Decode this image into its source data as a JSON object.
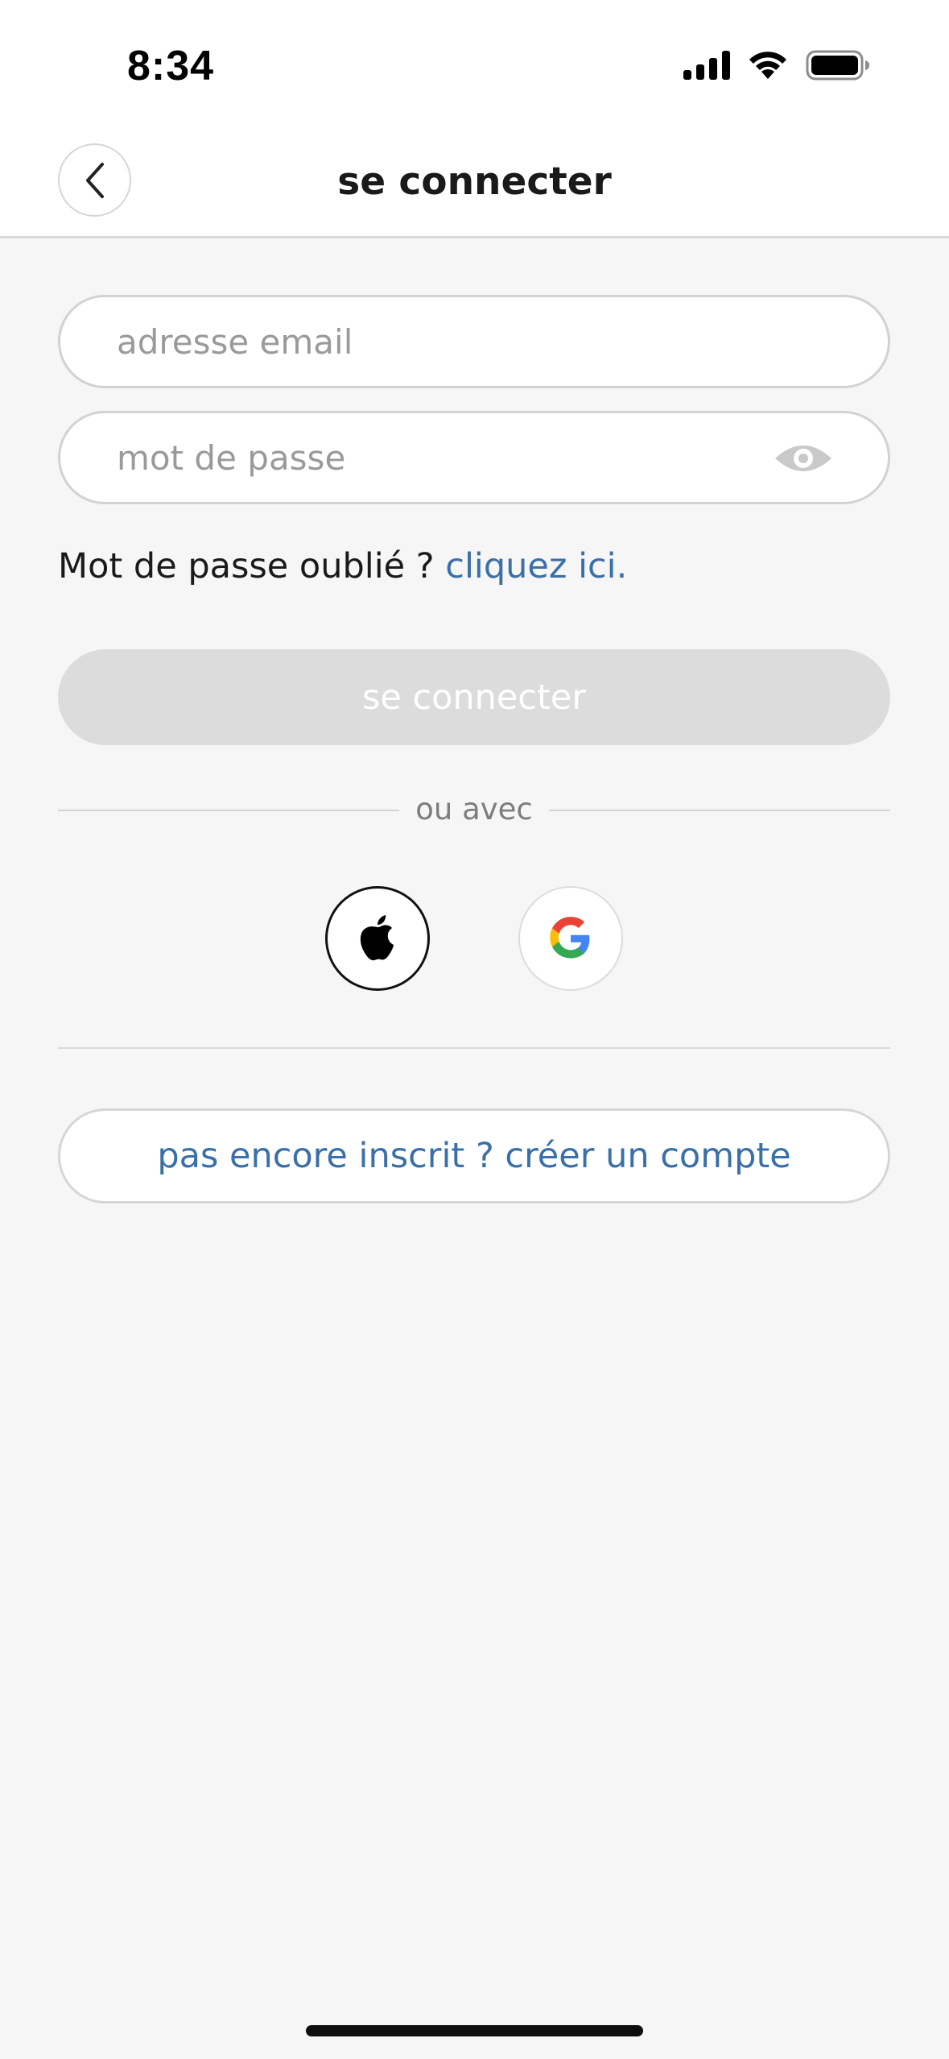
{
  "status_bar": {
    "time": "8:34",
    "icons": [
      "signal-icon",
      "wifi-icon",
      "battery-icon"
    ]
  },
  "header": {
    "title": "se connecter",
    "back_icon": "chevron-left-icon"
  },
  "form": {
    "email_placeholder": "adresse email",
    "email_value": "",
    "password_placeholder": "mot de passe",
    "password_value": "",
    "password_toggle_icon": "eye-icon",
    "forgot_text": "Mot de passe oublié ?",
    "forgot_link": "cliquez ici.",
    "login_button": "se connecter"
  },
  "social": {
    "divider_label": "ou avec",
    "providers": [
      "apple-icon",
      "google-icon"
    ]
  },
  "signup": {
    "label": "pas encore inscrit ? créer un compte"
  },
  "colors": {
    "background": "#f6f6f6",
    "link": "#3a6fa8",
    "button_disabled": "#dcdcdc",
    "border": "#d2d2d2"
  }
}
